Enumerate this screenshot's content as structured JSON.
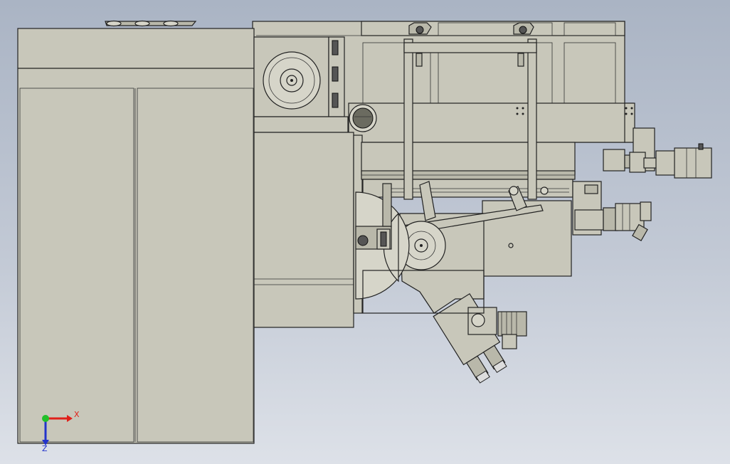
{
  "view": {
    "background_top": "#aab4c4",
    "background_bottom": "#dde1e8",
    "model_color": "#c8c7ba"
  },
  "triad": {
    "x_label": "X",
    "z_label": "Z",
    "x_color": "#e0201a",
    "y_color": "#22c02a",
    "z_color": "#2233cc"
  }
}
